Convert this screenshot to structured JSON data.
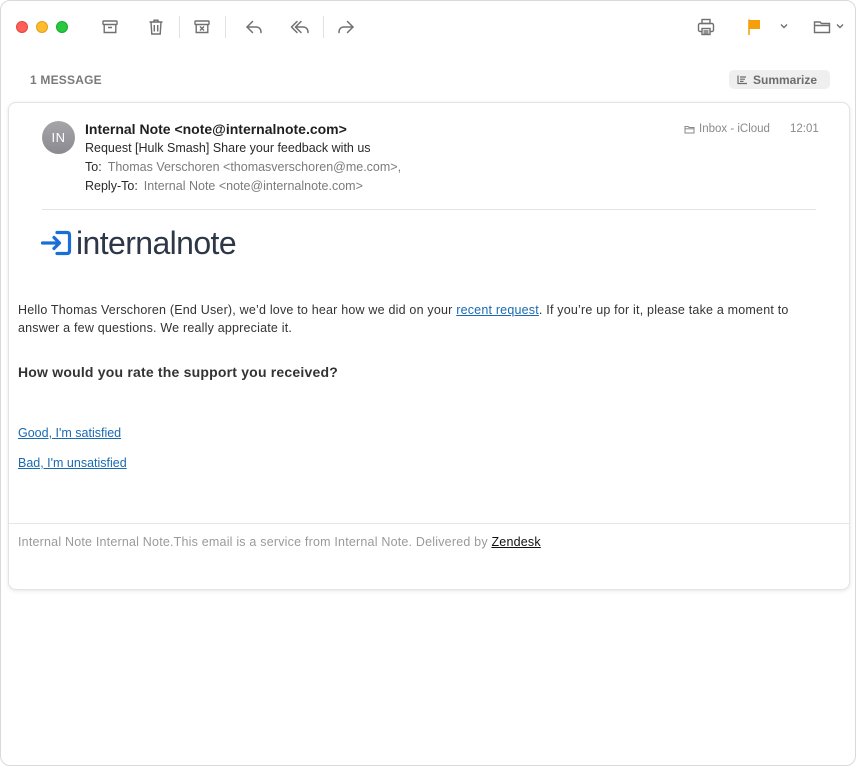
{
  "toolbar": {
    "buttons": [
      "archive-icon",
      "trash-icon",
      "junk-icon",
      "reply-icon",
      "reply-all-icon",
      "forward-icon",
      "print-icon",
      "flag-icon",
      "move-to-folder-icon"
    ],
    "flag_color": "#f5a00a"
  },
  "thread": {
    "count_label": "1 MESSAGE",
    "summarize_label": "Summarize"
  },
  "message": {
    "avatar_initials": "IN",
    "from": "Internal Note <note@internalnote.com>",
    "subject": "Request [Hulk Smash] Share your feedback with us",
    "to_label": "To:",
    "to_value": "Thomas Verschoren <thomasverschoren@me.com>,",
    "reply_to_label": "Reply-To:",
    "reply_to_value": "Internal Note <note@internalnote.com>",
    "mailbox": "Inbox - iCloud",
    "time": "12:01"
  },
  "content": {
    "logo_text": "internalnote",
    "logo_color": "#1a6fd6",
    "intro_before": "Hello Thomas Verschoren (End User), we’d love to hear how we did on your ",
    "intro_link": "recent request",
    "intro_after": ". If you’re up for it, please take a moment to answer a few questions. We really appreciate it.",
    "question": "How would you rate the support you received?",
    "good_link": "Good, I'm satisfied",
    "bad_link": "Bad, I'm unsatisfied",
    "footer_text": "Internal Note Internal Note.This email is a service from Internal Note. Delivered by ",
    "footer_link": "Zendesk"
  }
}
